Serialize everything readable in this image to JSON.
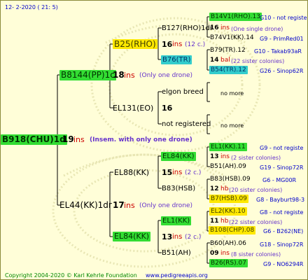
{
  "header": {
    "date": "12-  2-2020 ( 21:  5)"
  },
  "footer": {
    "copyright": "Copyright 2004-2020 © Karl Kehrle Foundation",
    "site": "www.pedigreeapis.org"
  },
  "root": {
    "id": "B918(CHU)1d",
    "num": "19",
    "ins": "ins",
    "note": "(Insem. with only one drone)"
  },
  "p1": {
    "id": "B8144(PP)1c",
    "num": "18",
    "ins": "ins",
    "note": "(Only one drone)"
  },
  "p2": {
    "id": "EL44(KK)1dr",
    "num": "17",
    "ins": "ins",
    "note": "(Only one drone)"
  },
  "g1": {
    "id": "B25(RHO)",
    "num": "16",
    "ins": "ins",
    "note": "(12 c.)"
  },
  "g2": {
    "id": "EL131(EO)",
    "num": "16"
  },
  "g3": {
    "id": "EL88(KK)",
    "num": "15",
    "ins": "ins",
    "note": "(2 c.)"
  },
  "g4": {
    "id": "EL84(KK)",
    "num": "13",
    "ins": "ins",
    "note": "(2 c.)"
  },
  "h1": {
    "id": "B127(RHO)1dr"
  },
  "h2": {
    "id": "B76(TR)"
  },
  "h3": {
    "id": "elgon breed"
  },
  "h4": {
    "id": "not registered"
  },
  "h5": {
    "id": "EL84(KK)"
  },
  "h6": {
    "id": "B83(HSB)"
  },
  "h7": {
    "id": "EL1(KK)"
  },
  "h8": {
    "id": "B51(AH)"
  },
  "no_more": "no more",
  "rows": [
    {
      "id": "B14V1(RHO).13",
      "info": "G10 - not registe"
    },
    {
      "num": "16",
      "ins": "ins",
      "note": "(One single drone)"
    },
    {
      "id": "B74V1(KK).14",
      "info": "G9 - PrimRed01"
    },
    {
      "id": "B79(TR).12",
      "info": "G10 - Takab93aR"
    },
    {
      "num": "14",
      "ins": "bal",
      "note": "(22 sister colonies)"
    },
    {
      "id": "B54(TR).12",
      "info": "G26 - Sinop62R"
    },
    {
      "id": "EL1(KK).11",
      "info": "G9 - not registe"
    },
    {
      "num": "13",
      "ins": "ins",
      "note": "(2 sister colonies)"
    },
    {
      "id": "B51(AH).09",
      "info": "G19 - Sinop72R"
    },
    {
      "id": "B83(HSB).09",
      "info": "G6 - MG00R"
    },
    {
      "num": "12",
      "ins": "hb",
      "note": "(20 sister colonies)"
    },
    {
      "id": "B7(HSB).09",
      "info": "G8 - Bayburt98-3"
    },
    {
      "id": "EL2(KK).10",
      "info": "G8 - not registe"
    },
    {
      "num": "11",
      "ins": "hb",
      "note": "(22 sister colonies)"
    },
    {
      "id": "B108(CHP).08",
      "info": "G6 - B262(NE)"
    },
    {
      "id": "B60(AH).06",
      "info": "G18 - Sinop72R"
    },
    {
      "num": "09",
      "ins": "ins",
      "note": "(8 sister colonies)"
    },
    {
      "id": "B26(RS).07",
      "info": "G9 - NO6294R"
    }
  ]
}
